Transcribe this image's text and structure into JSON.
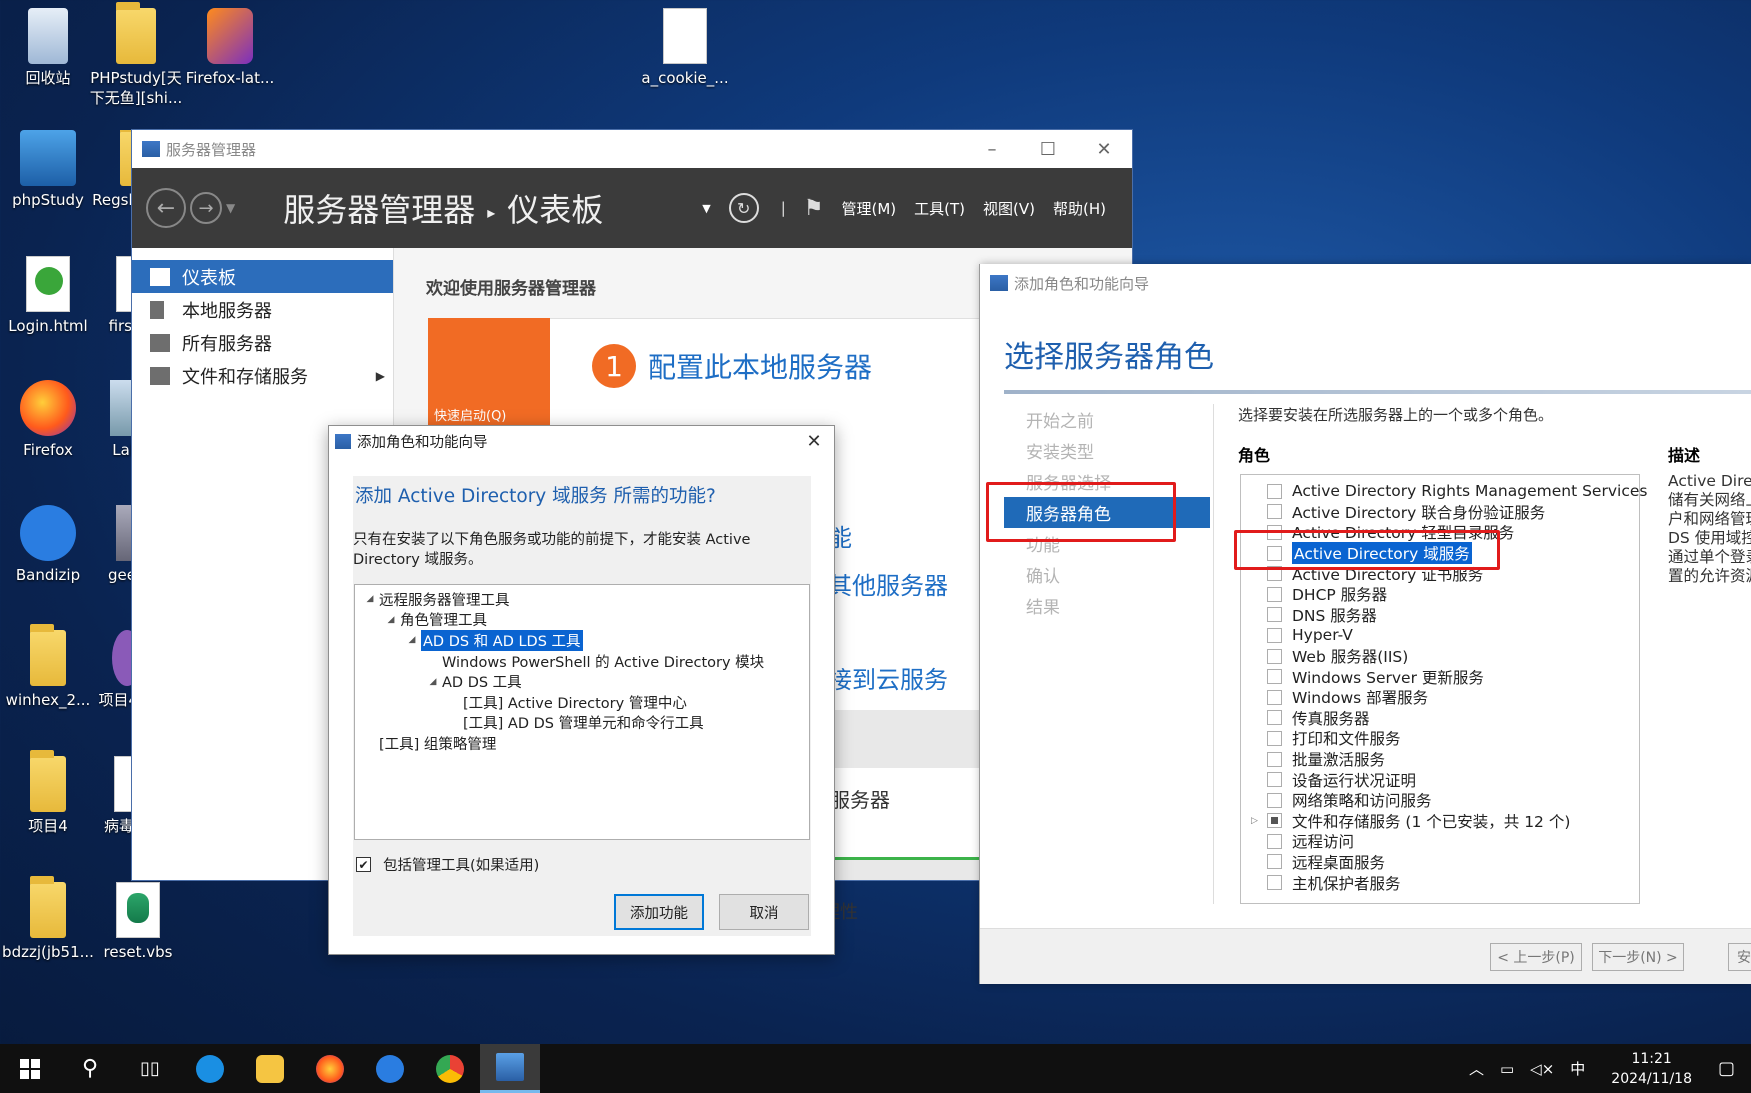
{
  "desktop": {
    "icons": [
      {
        "label": "回收站",
        "icon": "recycle-bin-icon"
      },
      {
        "label": "PHPstudy[天下无鱼][shi...",
        "icon": "folder-icon"
      },
      {
        "label": "Firefox-lat...",
        "icon": "installer-icon"
      },
      {
        "label": "a_cookie_...",
        "icon": "file-icon"
      },
      {
        "label": "phpStudy",
        "icon": "phpstudy-icon"
      },
      {
        "label": "Regsh",
        "icon": "folder-icon"
      },
      {
        "label": "Login.html",
        "icon": "html-file-icon"
      },
      {
        "label": "firs",
        "icon": "file-icon"
      },
      {
        "label": "Firefox",
        "icon": "firefox-icon"
      },
      {
        "label": "Lal",
        "icon": "app-icon"
      },
      {
        "label": "Bandizip",
        "icon": "bandizip-icon"
      },
      {
        "label": "gee",
        "icon": "app-icon"
      },
      {
        "label": "winhex_2...",
        "icon": "folder-icon"
      },
      {
        "label": "项目4",
        "icon": "app-icon"
      },
      {
        "label": "项目4",
        "icon": "folder-icon"
      },
      {
        "label": "病毒",
        "icon": "script-icon"
      },
      {
        "label": "bdzzj(jb51...",
        "icon": "folder-icon"
      },
      {
        "label": "reset.vbs",
        "icon": "vbs-script-icon"
      }
    ]
  },
  "server_manager": {
    "window_title": "服务器管理器",
    "breadcrumb_root": "服务器管理器",
    "breadcrumb_sep": "▸",
    "breadcrumb_page": "仪表板",
    "menu": [
      "管理(M)",
      "工具(T)",
      "视图(V)",
      "帮助(H)"
    ],
    "sidebar": [
      {
        "label": "仪表板",
        "icon": "dashboard-icon"
      },
      {
        "label": "本地服务器",
        "icon": "server-icon"
      },
      {
        "label": "所有服务器",
        "icon": "servers-icon"
      },
      {
        "label": "文件和存储服务",
        "icon": "storage-icon"
      }
    ],
    "welcome": "欢迎使用服务器管理器",
    "quickstart": "快速启动(Q)",
    "step_number": "1",
    "step_label": "配置此本地服务器",
    "link_fragments": [
      "能",
      "其他服务器",
      "接到云服务",
      "服务器",
      "理性"
    ]
  },
  "wizard": {
    "window_title": "添加角色和功能向导",
    "heading": "选择服务器角色",
    "steps": [
      "开始之前",
      "安装类型",
      "服务器选择",
      "服务器角色",
      "功能",
      "确认",
      "结果"
    ],
    "active_step_index": 3,
    "intro": "选择要安装在所选服务器上的一个或多个角色。",
    "roles_header": "角色",
    "desc_header": "描述",
    "roles": [
      {
        "label": "Active Directory Rights Management Services",
        "state": "unchecked"
      },
      {
        "label": "Active Directory 联合身份验证服务",
        "state": "unchecked"
      },
      {
        "label": "Active Directory 轻型目录服务",
        "state": "unchecked"
      },
      {
        "label": "Active Directory 域服务",
        "state": "unchecked",
        "selected": true
      },
      {
        "label": "Active Directory 证书服务",
        "state": "unchecked"
      },
      {
        "label": "DHCP 服务器",
        "state": "unchecked"
      },
      {
        "label": "DNS 服务器",
        "state": "unchecked"
      },
      {
        "label": "Hyper-V",
        "state": "unchecked"
      },
      {
        "label": "Web 服务器(IIS)",
        "state": "unchecked"
      },
      {
        "label": "Windows Server 更新服务",
        "state": "unchecked"
      },
      {
        "label": "Windows 部署服务",
        "state": "unchecked"
      },
      {
        "label": "传真服务器",
        "state": "unchecked"
      },
      {
        "label": "打印和文件服务",
        "state": "unchecked"
      },
      {
        "label": "批量激活服务",
        "state": "unchecked"
      },
      {
        "label": "设备运行状况证明",
        "state": "unchecked"
      },
      {
        "label": "网络策略和访问服务",
        "state": "unchecked"
      },
      {
        "label": "文件和存储服务 (1 个已安装，共 12 个)",
        "state": "partial",
        "expandable": true
      },
      {
        "label": "远程访问",
        "state": "unchecked"
      },
      {
        "label": "远程桌面服务",
        "state": "unchecked"
      },
      {
        "label": "主机保护者服务",
        "state": "unchecked"
      }
    ],
    "description_lines": [
      "Active Direc",
      "储有关网络上",
      "户和网络管理",
      "DS 使用域控",
      "通过单个登录",
      "置的允许资源"
    ],
    "prev_button": "< 上一步(P)",
    "next_button": "下一步(N) >",
    "install_button_fragment": "安"
  },
  "dialog": {
    "title": "添加角色和功能向导",
    "heading": "添加 Active Directory 域服务 所需的功能?",
    "body": "只有在安装了以下角色服务或功能的前提下，才能安装 Active Directory 域服务。",
    "tree": [
      {
        "label": "远程服务器管理工具",
        "level": 0,
        "expanded": true
      },
      {
        "label": "角色管理工具",
        "level": 1,
        "expanded": true
      },
      {
        "label": "AD DS 和 AD LDS 工具",
        "level": 2,
        "expanded": true,
        "selected": true
      },
      {
        "label": "Windows PowerShell 的 Active Directory 模块",
        "level": 3
      },
      {
        "label": "AD DS 工具",
        "level": 3,
        "expanded": true
      },
      {
        "label": "[工具] Active Directory 管理中心",
        "level": 4
      },
      {
        "label": "[工具] AD DS 管理单元和命令行工具",
        "level": 4
      },
      {
        "label": "[工具] 组策略管理",
        "level": 0
      }
    ],
    "include_tools_label": "包括管理工具(如果适用)",
    "include_tools_checked": true,
    "add_button": "添加功能",
    "cancel_button": "取消"
  },
  "taskbar": {
    "items": [
      "start-icon",
      "search-icon",
      "task-view-icon",
      "ie-icon",
      "file-explorer-icon",
      "firefox-icon",
      "bandizip-icon",
      "chrome-like-icon",
      "server-manager-icon"
    ],
    "ime": "中",
    "time": "11:21",
    "date": "2024/11/18"
  }
}
